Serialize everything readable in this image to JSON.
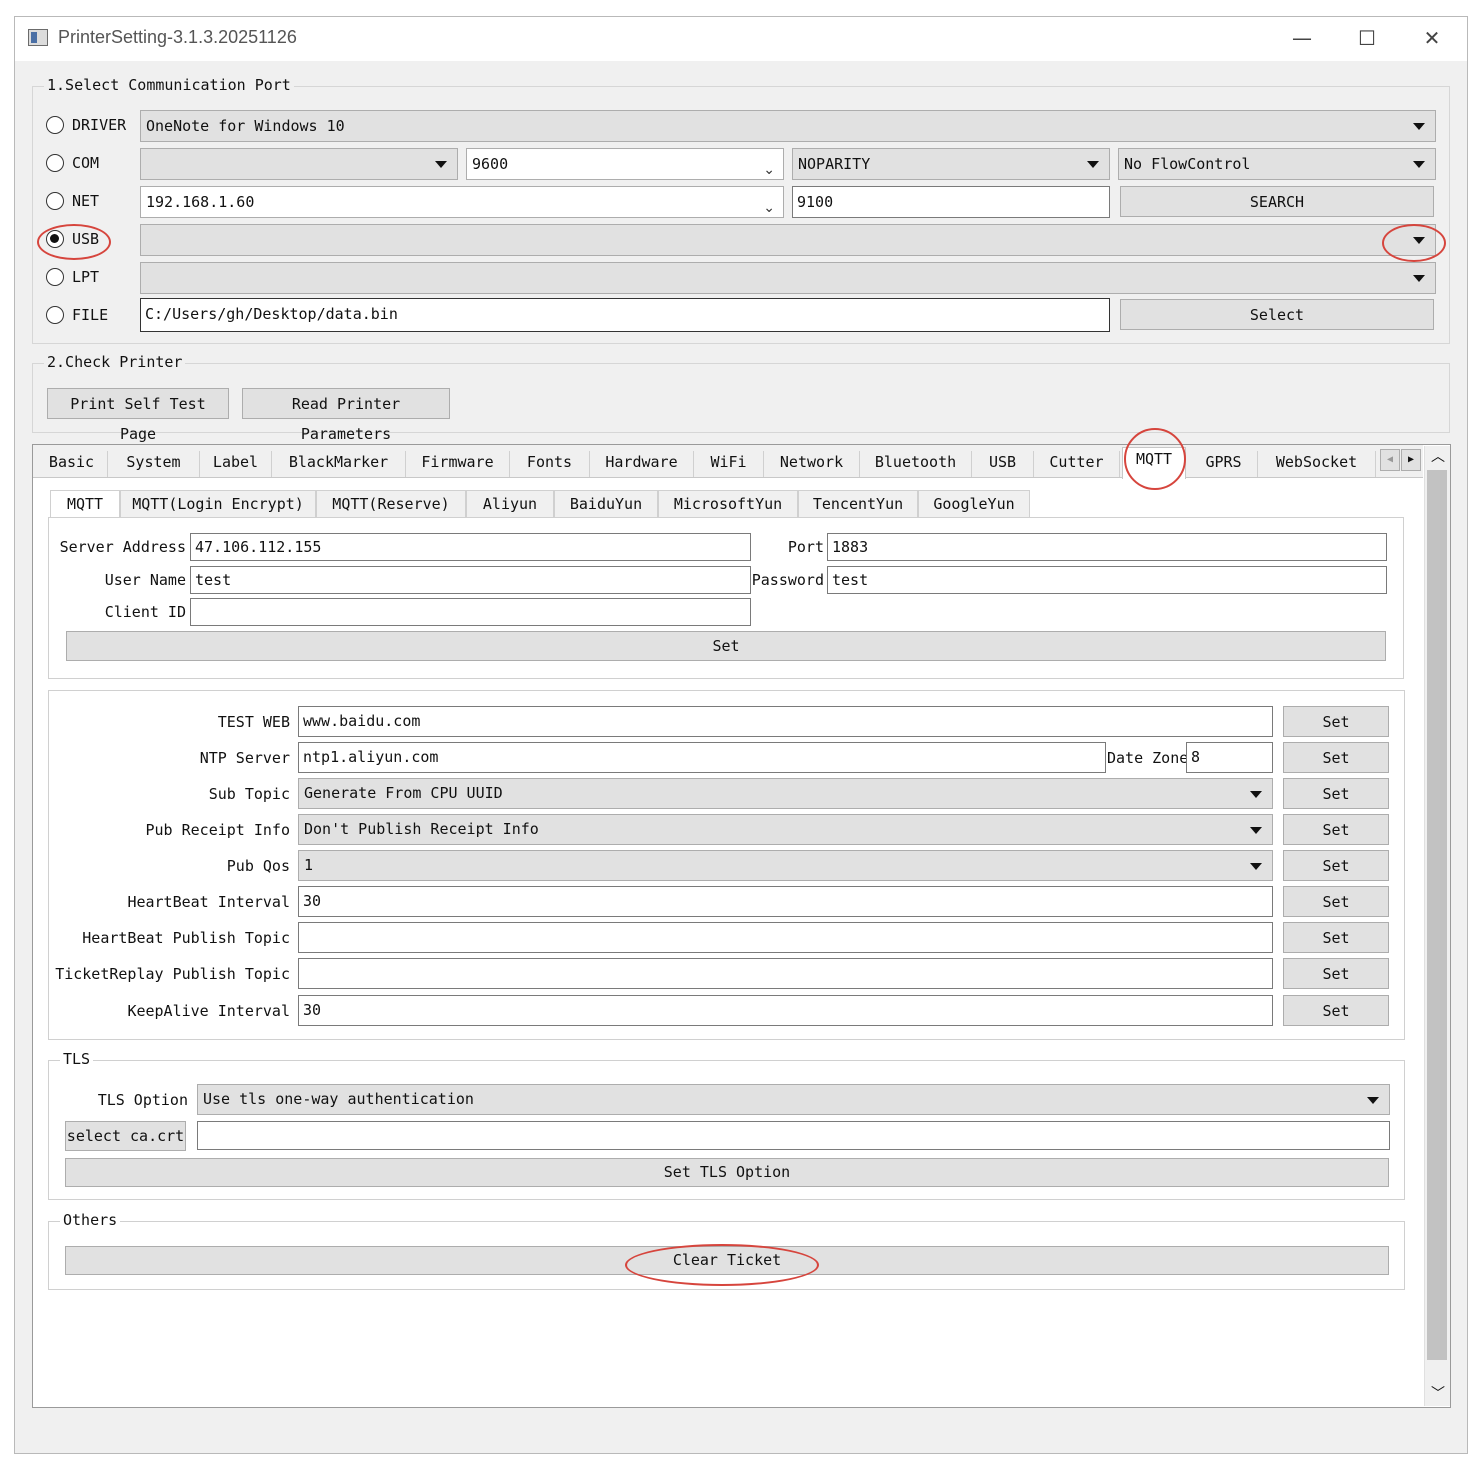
{
  "window": {
    "title": "PrinterSetting-3.1.3.20251126",
    "min": "—",
    "max": "☐",
    "close": "✕"
  },
  "port": {
    "legend": "1.Select Communication Port",
    "driver": {
      "label": "DRIVER",
      "value": "OneNote for Windows 10"
    },
    "com": {
      "label": "COM",
      "port": "",
      "baud": "9600",
      "parity": "NOPARITY",
      "flow": "No FlowControl"
    },
    "net": {
      "label": "NET",
      "ip": "192.168.1.60",
      "port": "9100",
      "search": "SEARCH"
    },
    "usb": {
      "label": "USB",
      "value": "",
      "checked": true
    },
    "lpt": {
      "label": "LPT",
      "value": ""
    },
    "file": {
      "label": "FILE",
      "path": "C:/Users/gh/Desktop/data.bin",
      "select": "Select"
    }
  },
  "check": {
    "legend": "2.Check Printer",
    "self_test": "Print Self Test Page",
    "read_params": "Read Printer Parameters"
  },
  "tabs": [
    "Basic",
    "System",
    "Label",
    "BlackMarker",
    "Firmware",
    "Fonts",
    "Hardware",
    "WiFi",
    "Network",
    "Bluetooth",
    "USB",
    "Cutter",
    "MQTT",
    "GPRS",
    "WebSocket"
  ],
  "tab_scroll": {
    "left": "◀",
    "right": "▶"
  },
  "subtabs": [
    "MQTT",
    "MQTT(Login Encrypt)",
    "MQTT(Reserve)",
    "Aliyun",
    "BaiduYun",
    "MicrosoftYun",
    "TencentYun",
    "GoogleYun"
  ],
  "mqtt": {
    "server_label": "Server Address",
    "server": "47.106.112.155",
    "port_label": "Port",
    "port": "1883",
    "user_label": "User Name",
    "user": "test",
    "pass_label": "Password",
    "pass": "test",
    "client_label": "Client ID",
    "client": "",
    "set": "Set"
  },
  "params": {
    "test_web": {
      "label": "TEST WEB",
      "value": "www.baidu.com"
    },
    "ntp": {
      "label": "NTP Server",
      "value": "ntp1.aliyun.com",
      "zone_label": "Date Zone",
      "zone": "8"
    },
    "sub_topic": {
      "label": "Sub Topic",
      "value": "Generate From CPU UUID"
    },
    "pub_receipt": {
      "label": "Pub Receipt Info",
      "value": "Don't Publish Receipt Info"
    },
    "pub_qos": {
      "label": "Pub Qos",
      "value": "1"
    },
    "hb_interval": {
      "label": "HeartBeat Interval",
      "value": "30"
    },
    "hb_topic": {
      "label": "HeartBeat Publish Topic",
      "value": ""
    },
    "ticket_topic": {
      "label": "TicketReplay Publish Topic",
      "value": ""
    },
    "keepalive": {
      "label": "KeepAlive Interval",
      "value": "30"
    },
    "set": "Set"
  },
  "tls": {
    "legend": "TLS",
    "option_label": "TLS Option",
    "option": "Use tls one-way authentication",
    "select_ca": "select ca.crt",
    "ca_path": "",
    "set": "Set TLS Option"
  },
  "others": {
    "legend": "Others",
    "clear": "Clear Ticket"
  },
  "scrollbar": {
    "up": "︿",
    "down": "﹀"
  },
  "accent": "#d6453d"
}
